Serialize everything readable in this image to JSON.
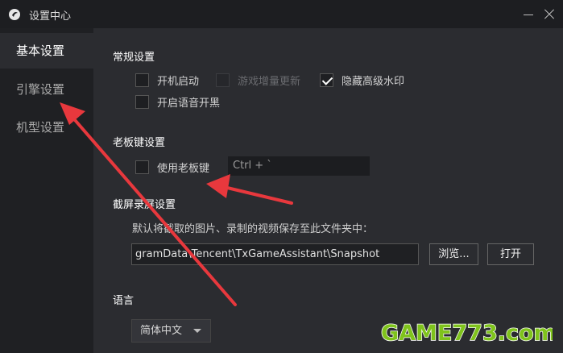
{
  "window": {
    "title": "设置中心"
  },
  "sidebar": {
    "items": [
      {
        "label": "基本设置",
        "active": true
      },
      {
        "label": "引擎设置",
        "active": false
      },
      {
        "label": "机型设置",
        "active": false
      }
    ]
  },
  "general": {
    "title": "常规设置",
    "options": [
      {
        "label": "开机启动",
        "checked": false,
        "disabled": false
      },
      {
        "label": "游戏增量更新",
        "checked": false,
        "disabled": true
      },
      {
        "label": "隐藏高级水印",
        "checked": true,
        "disabled": false
      },
      {
        "label": "开启语音开黑",
        "checked": false,
        "disabled": false
      }
    ]
  },
  "boss_key": {
    "title": "老板键设置",
    "option_label": "使用老板键",
    "checked": false,
    "hotkey_value": "Ctrl + `"
  },
  "screenshot": {
    "title": "截屏录屏设置",
    "description": "默认将截取的图片、录制的视频保存至此文件夹中：",
    "path_value": "gramData\\Tencent\\TxGameAssistant\\Snapshot",
    "browse_label": "浏览...",
    "open_label": "打开"
  },
  "language": {
    "title": "语言",
    "selected": "简体中文"
  },
  "watermark": {
    "text": "GAME773.com"
  },
  "colors": {
    "background": "#2b2c30",
    "sidebar": "#1f2023",
    "titlebar": "#1d1e21",
    "arrow": "#e8383d",
    "watermark_green": "#7fc31c",
    "watermark_orange": "#f39c12"
  }
}
